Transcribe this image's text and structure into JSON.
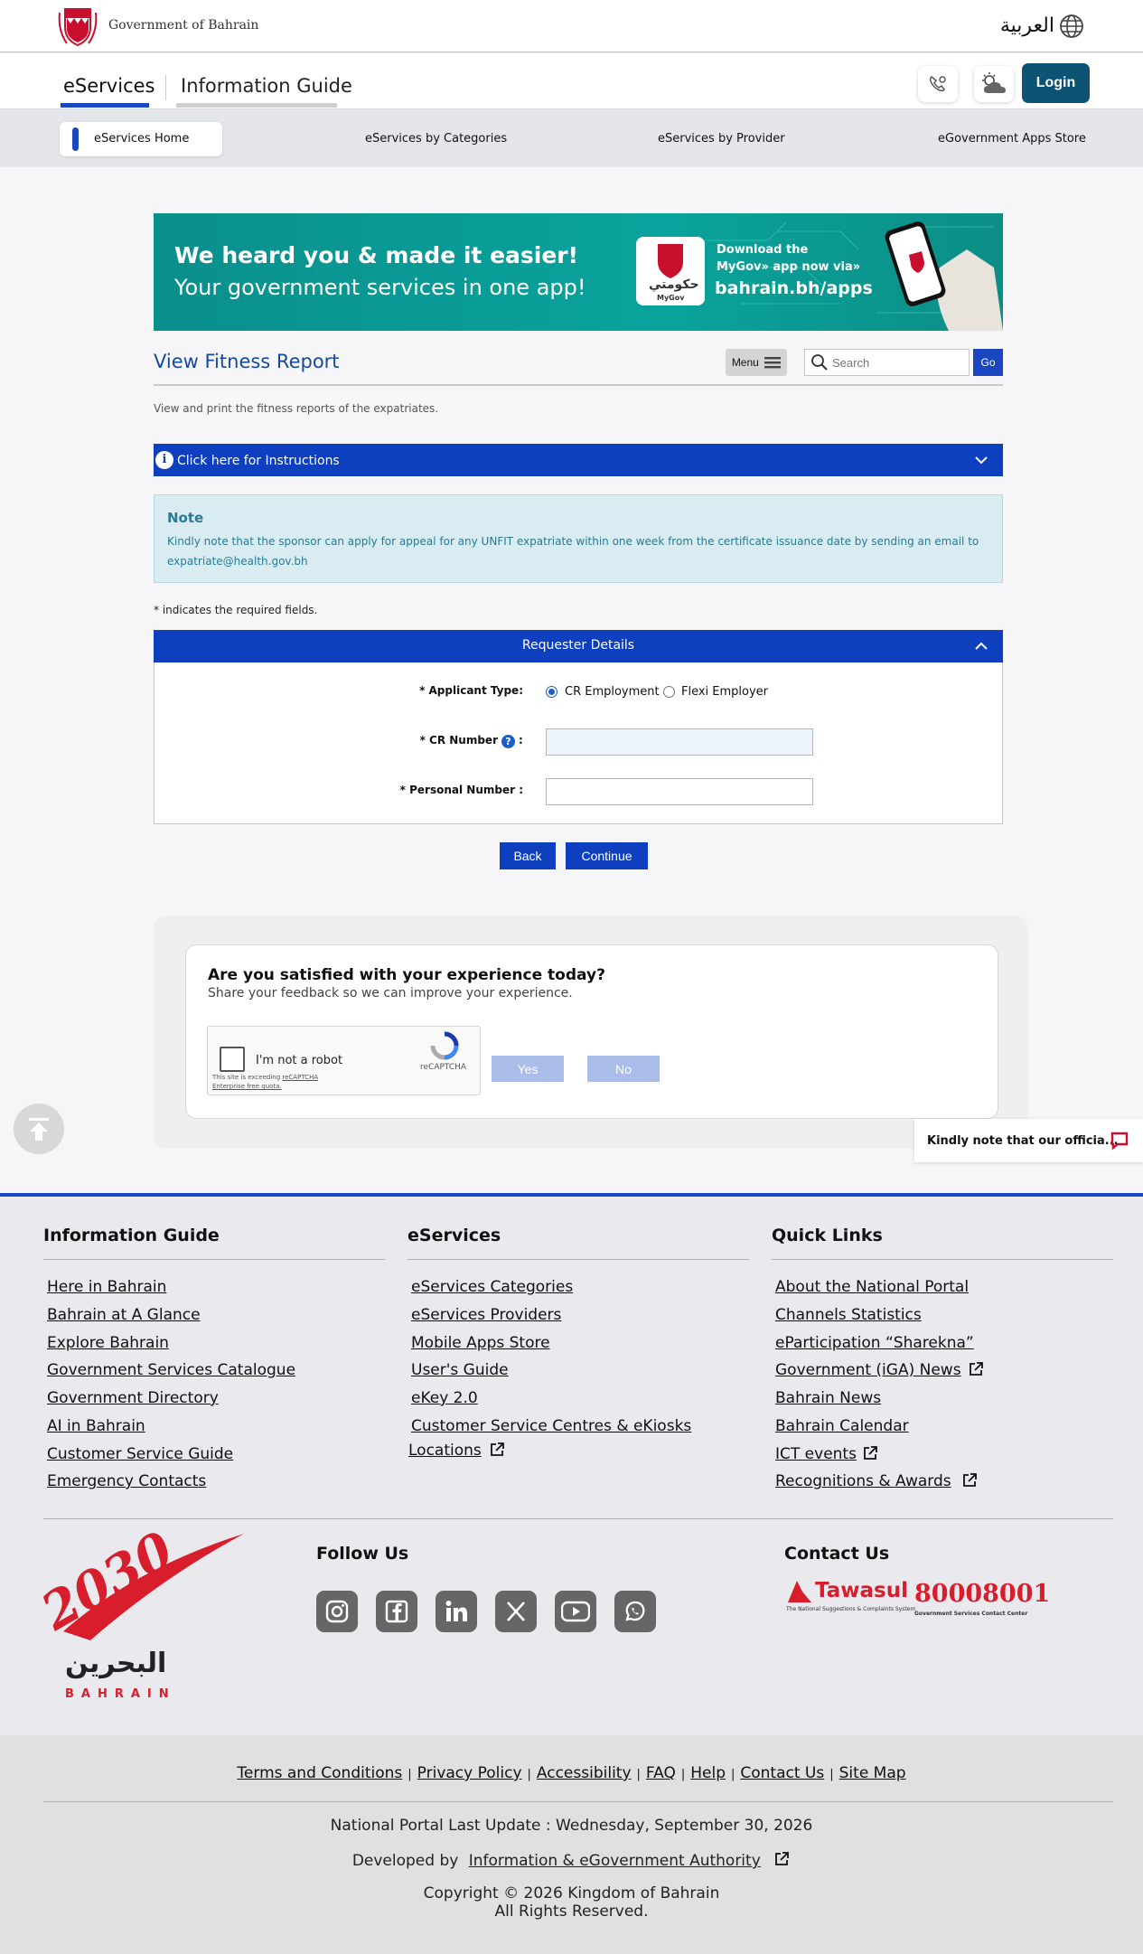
{
  "header": {
    "gov_name": "Government of Bahrain",
    "lang_label": "العربية",
    "tabs": [
      {
        "label": "eServices"
      },
      {
        "label": "Information Guide"
      }
    ],
    "login_label": "Login"
  },
  "categories": {
    "items": [
      {
        "label": "eServices Home"
      },
      {
        "label": "eServices by Categories"
      },
      {
        "label": "eServices by Provider"
      },
      {
        "label": "eGovernment Apps Store"
      }
    ]
  },
  "banner": {
    "line1": "We heard you & made it easier!",
    "line2": "Your government services in one app!",
    "download1": "Download the",
    "download2": "MyGov» app now via»",
    "url": "bahrain.bh/apps",
    "app_ar": "حكومتي",
    "app_en": "MyGov"
  },
  "page": {
    "title": "View Fitness Report",
    "menu_label": "Menu",
    "search_placeholder": "Search",
    "go_label": "Go",
    "subtitle": "View and print the fitness reports of the expatriates.",
    "instructions_label": "Click here for Instructions",
    "note_title": "Note",
    "note_text": "Kindly note that the sponsor can apply for appeal for any UNFIT expatriate within one week from the certificate issuance date by sending an email to expatriate@health.gov.bh",
    "required_note": "* indicates the required fields."
  },
  "form": {
    "section_title": "Requester Details",
    "applicant_type_label": "* Applicant Type:",
    "options": [
      {
        "label": "CR Employment",
        "selected": true
      },
      {
        "label": "Flexi Employer",
        "selected": false
      }
    ],
    "cr_label": "* CR Number",
    "cr_suffix": ":",
    "cr_value": "",
    "personal_label": "* Personal Number :",
    "personal_value": "",
    "back_label": "Back",
    "continue_label": "Continue"
  },
  "feedback": {
    "question": "Are you satisfied with your experience today?",
    "subtitle": "Share your feedback so we can improve your experience.",
    "captcha_label": "I'm not a robot",
    "captcha_brand": "reCAPTCHA",
    "captcha_note1": "This site is exceeding",
    "captcha_note2": "reCAPTCHA",
    "captcha_note3": "Enterprise free quota.",
    "yes_label": "Yes",
    "no_label": "No"
  },
  "notice": {
    "text": "Kindly note that our officia..."
  },
  "footer": {
    "info_guide": {
      "title": "Information Guide",
      "links": [
        "Here in Bahrain",
        "Bahrain at A Glance",
        "Explore Bahrain",
        "Government Services Catalogue",
        "Government Directory",
        "AI in Bahrain",
        "Customer Service Guide",
        "Emergency Contacts"
      ]
    },
    "eservices": {
      "title": "eServices",
      "links": [
        "eServices Categories",
        "eServices Providers",
        "Mobile Apps Store",
        "User's Guide",
        "eKey 2.0",
        "Customer Service Centres & eKiosks",
        "Locations"
      ]
    },
    "quick_links": {
      "title": "Quick Links",
      "links": [
        "About the National Portal",
        "Channels Statistics",
        "eParticipation “Sharekna”",
        "Government (iGA) News",
        "Bahrain News",
        "Bahrain Calendar",
        "ICT events",
        "Recognitions & Awards"
      ]
    },
    "vision_ar": "البحرين",
    "vision_en": "BAHRAIN",
    "vision_year": "2030",
    "follow_title": "Follow Us",
    "contact_title": "Contact Us",
    "tawasul": "Tawasul",
    "tawasul_sub": "The National Suggestions & Complaints System",
    "contact_number": "80008001",
    "contact_number_sub": "Government Services Contact Center",
    "bottom_links": [
      "Terms and Conditions",
      "Privacy Policy",
      "Accessibility",
      "FAQ",
      "Help",
      "Contact Us",
      "Site Map"
    ],
    "bottom_sep": "|",
    "last_update": "National Portal Last Update : Wednesday, September 30, 2026",
    "developed_by": "Developed by",
    "developer": "Information & eGovernment Authority",
    "copyright": "Copyright © 2026 Kingdom of Bahrain",
    "rights": "All Rights Reserved."
  },
  "colors": {
    "primary_blue": "#0d3fbf",
    "title_blue": "#154a9c",
    "login_teal": "#0d5374",
    "note_bg": "#d9ecf2",
    "banner_teal": "#0a9a95"
  }
}
